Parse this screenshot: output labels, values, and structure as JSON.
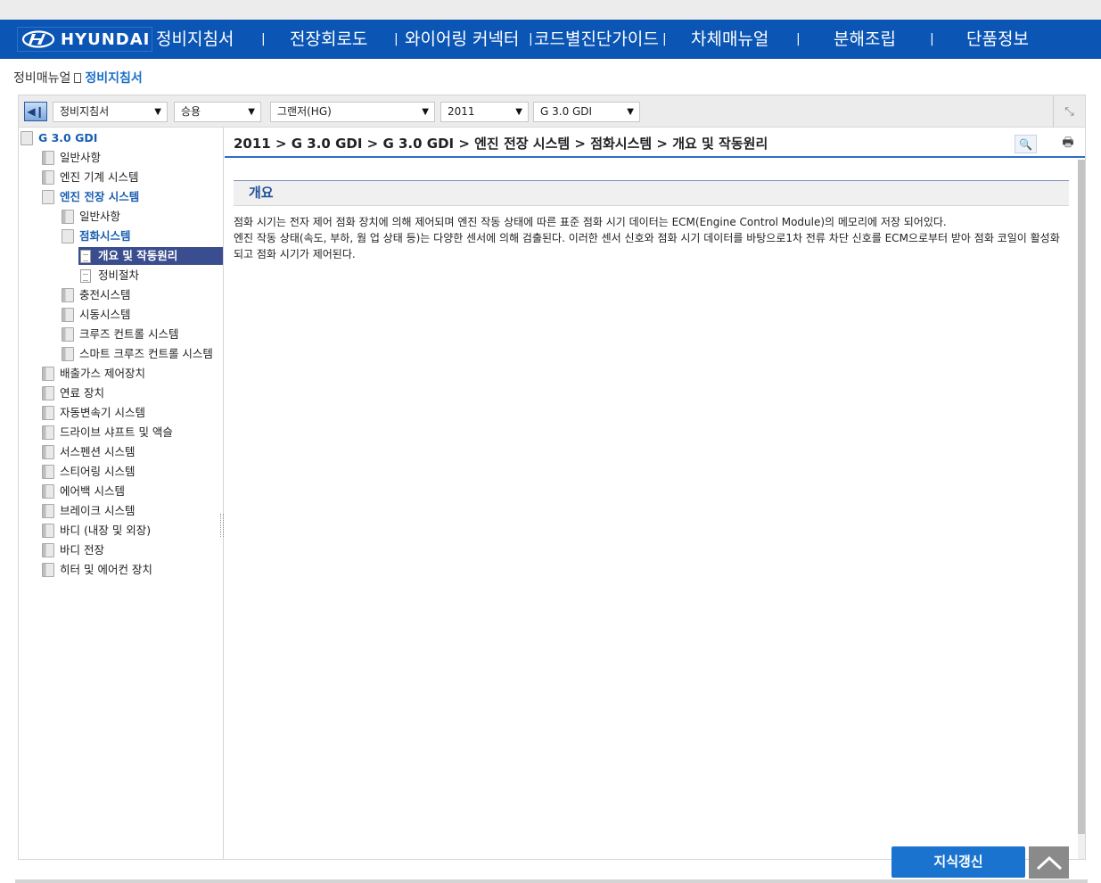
{
  "header": {
    "brand": "HYUNDAI",
    "nav": [
      {
        "label": "정비지침서"
      },
      {
        "label": "전장회로도"
      },
      {
        "label": "와이어링 커넥터"
      },
      {
        "label": "코드별진단가이드"
      },
      {
        "label": "차체매뉴얼"
      },
      {
        "label": "분해조립"
      },
      {
        "label": "단품정보"
      }
    ],
    "separator": "|"
  },
  "breadcrumb": {
    "parent": "정비매뉴얼",
    "current": "정비지침서"
  },
  "filters": {
    "manual_type": "정비지침서",
    "vehicle_class": "승용",
    "model": "그랜저(HG)",
    "year": "2011",
    "engine": "G 3.0 GDI"
  },
  "tree": {
    "root": "G 3.0 GDI",
    "items": [
      {
        "label": "일반사항"
      },
      {
        "label": "엔진 기계 시스템"
      },
      {
        "label": "엔진 전장 시스템"
      },
      {
        "label": "일반사항"
      },
      {
        "label": "점화시스템"
      },
      {
        "label": "개요 및 작동원리"
      },
      {
        "label": "정비절차"
      },
      {
        "label": "충전시스템"
      },
      {
        "label": "시동시스템"
      },
      {
        "label": "크루즈 컨트롤 시스템"
      },
      {
        "label": "스마트 크루즈 컨트롤 시스템"
      },
      {
        "label": "배출가스 제어장치"
      },
      {
        "label": "연료 장치"
      },
      {
        "label": "자동변속기 시스템"
      },
      {
        "label": "드라이브 샤프트 및 액슬"
      },
      {
        "label": "서스펜션 시스템"
      },
      {
        "label": "스티어링 시스템"
      },
      {
        "label": "에어백 시스템"
      },
      {
        "label": "브레이크 시스템"
      },
      {
        "label": "바디 (내장 및 외장)"
      },
      {
        "label": "바디 전장"
      },
      {
        "label": "히터 및 에어컨 장치"
      }
    ]
  },
  "content": {
    "path": "2011 > G 3.0 GDI > G 3.0 GDI > 엔진 전장 시스템 > 점화시스템 > 개요 및 작동원리",
    "section_title": "개요",
    "paragraph1": "점화 시기는 전자 제어 점화 장치에 의해 제어되며 엔진 작동 상태에 따른 표준 점화 시기 데이터는 ECM(Engine Control Module)의 메모리에 저장 되어있다.",
    "paragraph2": "엔진 작동 상태(속도, 부하, 웜 업 상태 등)는 다양한 센서에 의해 검출된다. 이러한 센서 신호와 점화 시기 데이터를 바탕으로1차 전류 차단 신호를 ECM으로부터 받아 점화 코일이 활성화 되고 점화 시기가 제어된다."
  },
  "buttons": {
    "knowledge": "지식갱신"
  },
  "colors": {
    "header_bg": "#0b55b4",
    "selected_bg": "#3a4d8f",
    "accent": "#1a74cf"
  }
}
